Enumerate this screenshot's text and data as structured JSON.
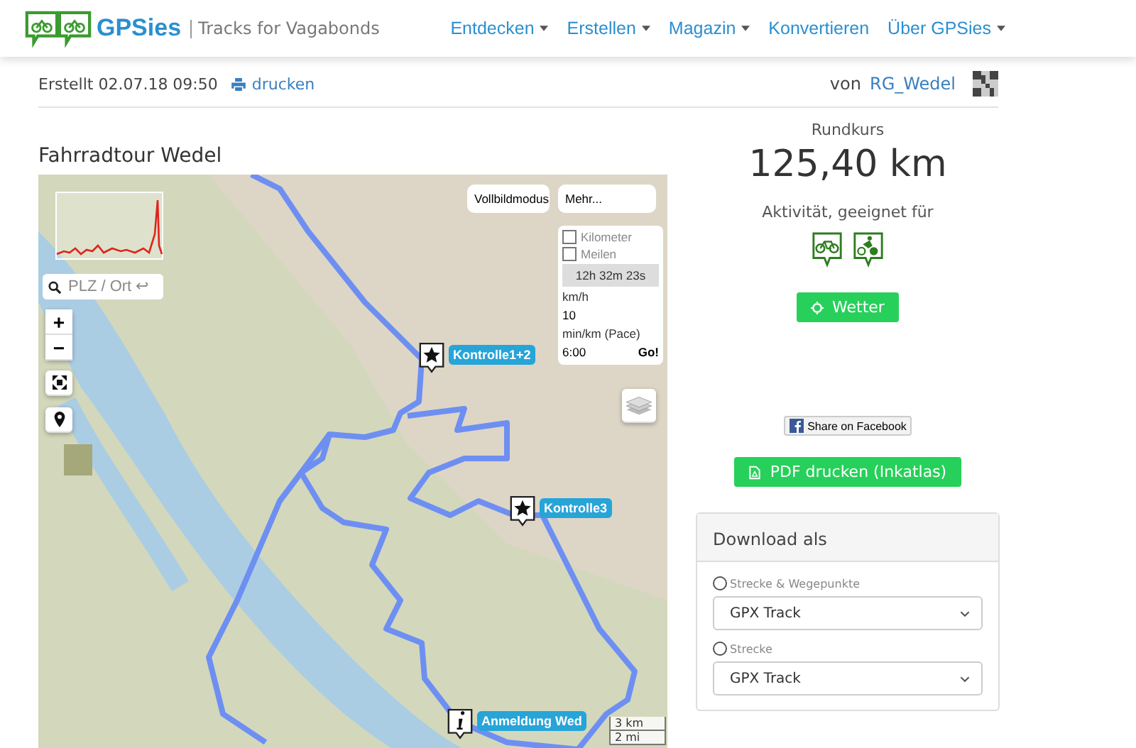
{
  "header": {
    "logo": "GPSies",
    "tagline": "Tracks for Vagabonds",
    "nav": [
      {
        "label": "Entdecken",
        "dropdown": true
      },
      {
        "label": "Erstellen",
        "dropdown": true
      },
      {
        "label": "Magazin",
        "dropdown": true
      },
      {
        "label": "Konvertieren",
        "dropdown": false
      },
      {
        "label": "Über GPSies",
        "dropdown": true
      }
    ]
  },
  "meta": {
    "created": "Erstellt 02.07.18 09:50",
    "print": "drucken",
    "by": "von",
    "author": "RG_Wedel"
  },
  "track": {
    "title": "Fahrradtour Wedel"
  },
  "map": {
    "search": {
      "placeholder": "PLZ / Ort ↩"
    },
    "zoom_in": "+",
    "zoom_out": "−",
    "fullscreen": "Vollbildmodus",
    "more": "Mehr...",
    "units": [
      {
        "label": "Kilometer",
        "checked": false
      },
      {
        "label": "Meilen",
        "checked": false
      }
    ],
    "duration": "12h 32m 23s",
    "speed_label": "km/h",
    "speed": "10",
    "pace_label": "min/km (Pace)",
    "pace": "6:00",
    "go": "Go!",
    "markers": [
      {
        "kind": "star",
        "label": "Kontrolle1+2"
      },
      {
        "kind": "star",
        "label": "Kontrolle3"
      },
      {
        "kind": "info",
        "label": "Anmeldung Wed"
      }
    ],
    "scale": [
      "3 km",
      "2 mi"
    ]
  },
  "summary": {
    "type": "Rundkurs",
    "distance": "125,40 km",
    "activity_label": "Aktivität, geeignet für",
    "weather": "Wetter",
    "share": "Share on Facebook",
    "pdf": "PDF drucken (Inkatlas)"
  },
  "download": {
    "title": "Download als",
    "options": [
      {
        "label": "Strecke & Wegepunkte",
        "selected": false,
        "format": "GPX Track"
      },
      {
        "label": "Strecke",
        "selected": false,
        "format": "GPX Track"
      }
    ]
  }
}
